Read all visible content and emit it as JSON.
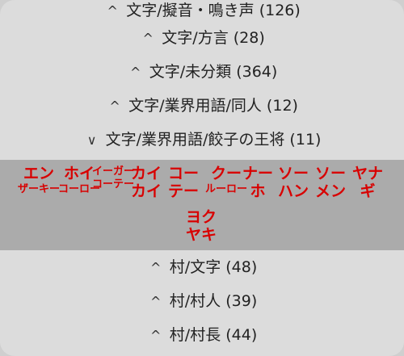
{
  "categories_top": [
    {
      "label": "文字/擬音・鳴き声 (126)",
      "chevron": "^"
    },
    {
      "label": "文字/方言 (28)",
      "chevron": "^"
    },
    {
      "label": "文字/未分類 (364)",
      "chevron": "^"
    },
    {
      "label": "文字/業界用語/同人 (12)",
      "chevron": "^"
    },
    {
      "label": "文字/業界用語/餃子の王将 (11)",
      "chevron": "∨"
    }
  ],
  "entries": [
    {
      "line1": "エン",
      "line2": "ザーキー"
    },
    {
      "line1": "ホイ",
      "line2": "コーロー"
    },
    {
      "line1": "イーガー",
      "line2": "コーテー"
    },
    {
      "line1": "カイ",
      "line2": "カイ"
    },
    {
      "line1": "コー",
      "line2": "テー"
    },
    {
      "line1": "クー",
      "line2": "ルーロー"
    },
    {
      "line1": "ナー",
      "line2": "ホ"
    },
    {
      "line1": "ソー",
      "line2": "ハン"
    },
    {
      "line1": "ソー",
      "line2": "メン"
    },
    {
      "line1": "ヤナ",
      "line2": "ギ"
    },
    {
      "line1": "ヨク",
      "line2": "ヤキ"
    }
  ],
  "categories_bottom": [
    {
      "label": "村/文字 (48)",
      "chevron": "^"
    },
    {
      "label": "村/村人 (39)",
      "chevron": "^"
    },
    {
      "label": "村/村長 (44)",
      "chevron": "^"
    }
  ]
}
